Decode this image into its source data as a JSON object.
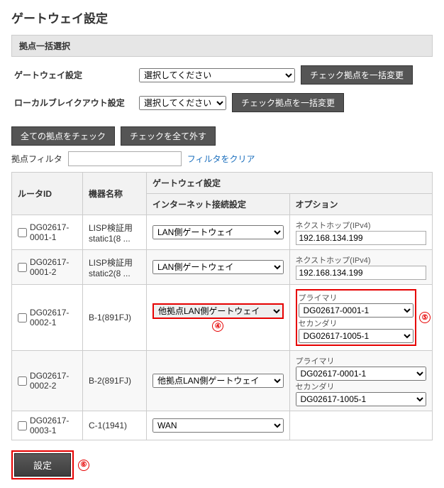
{
  "page_title": "ゲートウェイ設定",
  "bulk_section_title": "拠点一括選択",
  "bulk": {
    "gateway_label": "ゲートウェイ設定",
    "gateway_select": "選択してください",
    "gateway_btn": "チェック拠点を一括変更",
    "lbo_label": "ローカルブレイクアウト設定",
    "lbo_select": "選択してください",
    "lbo_btn": "チェック拠点を一括変更"
  },
  "buttons": {
    "check_all": "全ての拠点をチェック",
    "uncheck_all": "チェックを全て外す"
  },
  "filter": {
    "label": "拠点フィルタ",
    "value": "",
    "clear": "フィルタをクリア"
  },
  "table": {
    "headers": {
      "router_id": "ルータID",
      "device_name": "機器名称",
      "gateway_group": "ゲートウェイ設定",
      "connection": "インターネット接続設定",
      "option": "オプション"
    },
    "rows": [
      {
        "id": "DG02617-0001-1",
        "name": "LISP検証用 static1(8 ...",
        "conn": "LAN側ゲートウェイ",
        "opt_type": "nexthop",
        "opt_label": "ネクストホップ(IPv4)",
        "opt_value": "192.168.134.199"
      },
      {
        "id": "DG02617-0001-2",
        "name": "LISP検証用 static2(8 ...",
        "conn": "LAN側ゲートウェイ",
        "opt_type": "nexthop",
        "opt_label": "ネクストホップ(IPv4)",
        "opt_value": "192.168.134.199"
      },
      {
        "id": "DG02617-0002-1",
        "name": "B-1(891FJ)",
        "conn": "他拠点LAN側ゲートウェイ",
        "opt_type": "primary_secondary",
        "primary_label": "プライマリ",
        "primary_value": "DG02617-0001-1",
        "secondary_label": "セカンダリ",
        "secondary_value": "DG02617-1005-1",
        "highlight": true
      },
      {
        "id": "DG02617-0002-2",
        "name": "B-2(891FJ)",
        "conn": "他拠点LAN側ゲートウェイ",
        "opt_type": "primary_secondary",
        "primary_label": "プライマリ",
        "primary_value": "DG02617-0001-1",
        "secondary_label": "セカンダリ",
        "secondary_value": "DG02617-1005-1"
      },
      {
        "id": "DG02617-0003-1",
        "name": "C-1(1941)",
        "conn": "WAN",
        "opt_type": "none"
      }
    ]
  },
  "submit": "設定",
  "annotations": {
    "n4": "④",
    "n5": "⑤",
    "n6": "⑥"
  }
}
